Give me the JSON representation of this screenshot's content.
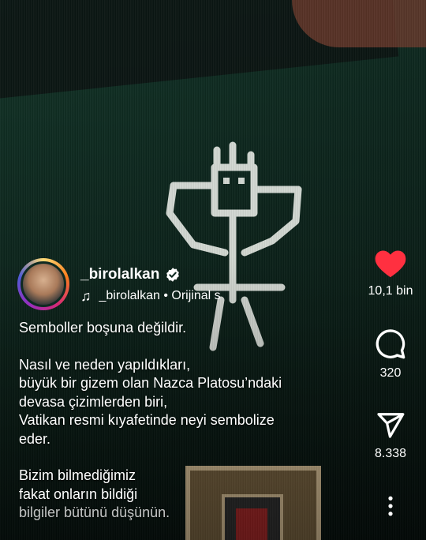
{
  "post": {
    "username": "_birolalkan",
    "audio": "_birolalkan • Orijinal s",
    "caption": [
      "Semboller boşuna değildir.",
      "",
      "Nasıl ve neden yapıldıkları,",
      "büyük bir gizem olan Nazca Platosu’ndaki",
      "devasa çizimlerden biri,",
      "Vatikan resmi kıyafetinde neyi sembolize",
      "eder.",
      "",
      "Bizim bilmediğimiz",
      "fakat onların bildiği",
      "bilgiler bütünü düşünün."
    ]
  },
  "actions": {
    "likes": "10,1 bin",
    "comments": "320",
    "shares": "8.338"
  },
  "colors": {
    "like": "#ff3040",
    "text": "#ffffff",
    "verified": "#ffffff"
  },
  "icons": {
    "like": "heart-icon",
    "comment": "comment-icon",
    "share": "paper-plane-icon",
    "more": "more-vertical-icon",
    "music": "music-note-icon",
    "verified": "verified-badge-icon"
  }
}
